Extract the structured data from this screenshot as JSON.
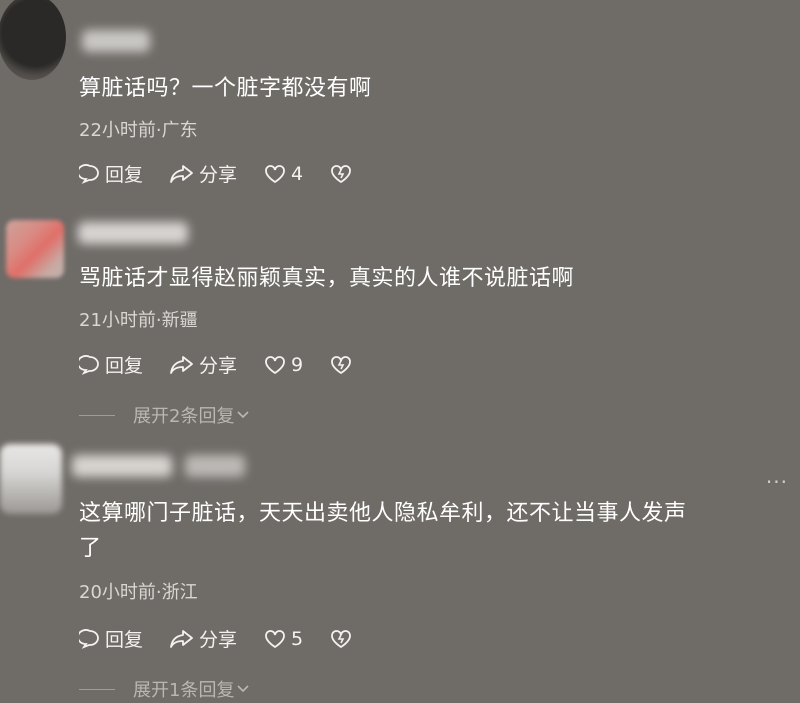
{
  "comments": [
    {
      "text": "算脏话吗？一个脏字都没有啊",
      "meta": "22小时前·广东",
      "reply_label": "回复",
      "share_label": "分享",
      "likes": "4"
    },
    {
      "text": "骂脏话才显得赵丽颖真实，真实的人谁不说脏话啊",
      "meta": "21小时前·新疆",
      "reply_label": "回复",
      "share_label": "分享",
      "likes": "9",
      "expand_label": "展开2条回复"
    },
    {
      "text_line1": "这算哪门子脏话，天天出卖他人隐私牟利，还不让当事人发声",
      "text_line2": "了",
      "meta": "20小时前·浙江",
      "reply_label": "回复",
      "share_label": "分享",
      "likes": "5",
      "expand_label": "展开1条回复",
      "more_label": "···"
    }
  ],
  "icons": [
    "reply-icon",
    "share-icon",
    "like-icon",
    "dislike-icon",
    "chevron-down-icon"
  ]
}
